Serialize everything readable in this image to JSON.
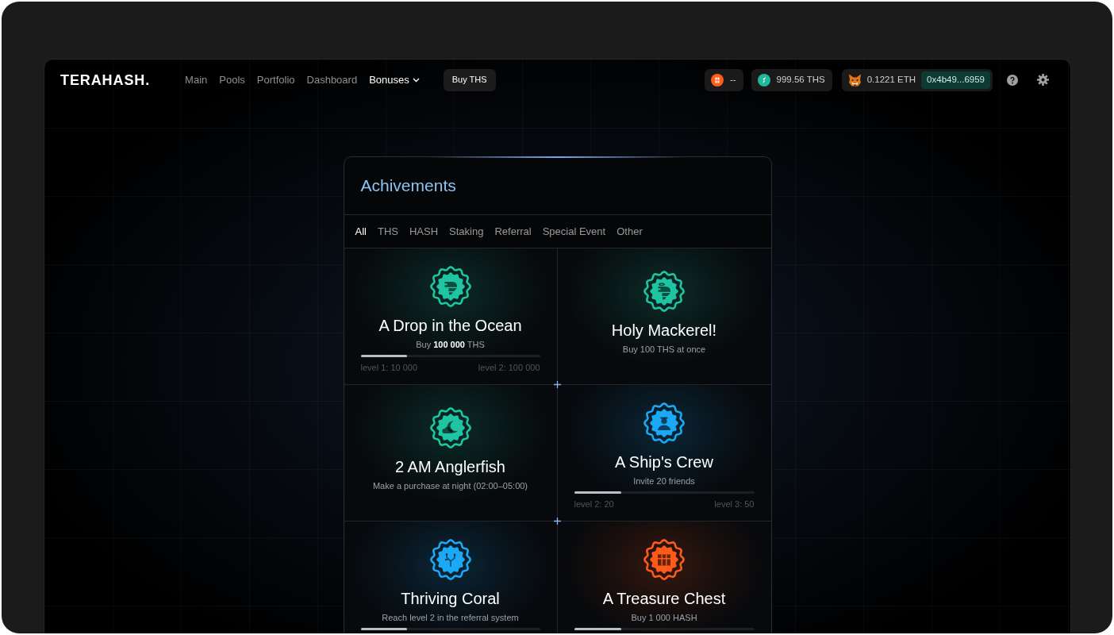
{
  "header": {
    "logo": "TERAHASH.",
    "nav": [
      {
        "label": "Main",
        "selected": false,
        "dropdown": false
      },
      {
        "label": "Pools",
        "selected": false,
        "dropdown": false
      },
      {
        "label": "Portfolio",
        "selected": false,
        "dropdown": false
      },
      {
        "label": "Dashboard",
        "selected": false,
        "dropdown": false
      },
      {
        "label": "Bonuses",
        "selected": true,
        "dropdown": true
      }
    ],
    "buy_button": "Buy THS",
    "hash_balance": "--",
    "ths_balance": "999.56 THS",
    "eth_balance": "0.1221 ETH",
    "wallet_address": "0x4b49...6959"
  },
  "achievements": {
    "title": "Achivements",
    "tabs": [
      {
        "label": "All",
        "selected": true
      },
      {
        "label": "THS",
        "selected": false
      },
      {
        "label": "HASH",
        "selected": false
      },
      {
        "label": "Staking",
        "selected": false
      },
      {
        "label": "Referral",
        "selected": false
      },
      {
        "label": "Special Event",
        "selected": false
      },
      {
        "label": "Other",
        "selected": false
      }
    ],
    "items": [
      {
        "title": "A Drop in the Ocean",
        "description": "Buy **100 000** THS",
        "color": "#1fc5a2",
        "level": 0.26,
        "level_from": "level 1: 10 000",
        "level_to": "level 2: 100 000"
      },
      {
        "title": "Holy Mackerel!",
        "description": "Buy 100 THS at once",
        "color": "#1fc5a2"
      },
      {
        "title": "2 AM Anglerfish",
        "description": "Make a purchase at night (02:00–05:00)",
        "color": "#1fc5a2"
      },
      {
        "title": "A Ship's Crew",
        "description": "Invite 20 friends",
        "color": "#1ba8f5",
        "level": 0.26,
        "level_from": "level 2: 20",
        "level_to": "level 3: 50"
      },
      {
        "title": "Thriving Coral",
        "description": "Reach level 2 in the referral system",
        "color": "#1ba8f5",
        "level": 0.26
      },
      {
        "title": "A Treasure Chest",
        "description": "Buy 1 000 HASH",
        "color": "#ff5a1a",
        "level": 0.26
      }
    ]
  }
}
